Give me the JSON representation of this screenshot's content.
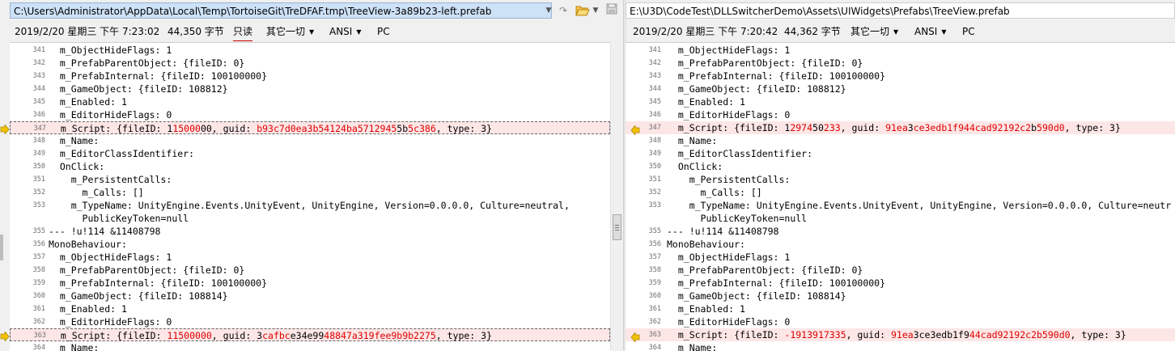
{
  "left": {
    "path": "C:\\Users\\Administrator\\AppData\\Local\\Temp\\TortoiseGit\\TreDFAF.tmp\\TreeView-3a89b23-left.prefab",
    "info": {
      "datetime": "2019/2/20 星期三 下午 7:23:02",
      "size": "44,350 字节",
      "readonly": "只读",
      "linefeed": "其它一切",
      "encoding": "ANSI",
      "platform": "PC"
    }
  },
  "right": {
    "path": "E:\\U3D\\CodeTest\\DLLSwitcherDemo\\Assets\\UIWidgets\\Prefabs\\TreeView.prefab",
    "info": {
      "datetime": "2019/2/20 星期三 下午 7:20:42",
      "size": "44,362 字节",
      "linefeed": "其它一切",
      "encoding": "ANSI",
      "platform": "PC"
    }
  },
  "icons": {
    "dropdown": "chevron-down-icon",
    "goto": "goto-icon",
    "open": "folder-open-icon",
    "save": "save-icon",
    "left_diff_arrow": "arrow-right-icon",
    "right_diff_arrow": "arrow-left-icon"
  },
  "colors": {
    "diff_bg": "#fde6e6",
    "diff_text": "#e00000",
    "arrow": "#f2c200",
    "path_selected_bg": "#cde1f7"
  },
  "left_lines": [
    {
      "n": "341",
      "segs": [
        {
          "t": "  m_ObjectHideFlags: 1"
        }
      ]
    },
    {
      "n": "342",
      "segs": [
        {
          "t": "  m_PrefabParentObject: {fileID: 0}"
        }
      ]
    },
    {
      "n": "343",
      "segs": [
        {
          "t": "  m_PrefabInternal: {fileID: 100100000}"
        }
      ]
    },
    {
      "n": "344",
      "segs": [
        {
          "t": "  m_GameObject: {fileID: 108812}"
        }
      ]
    },
    {
      "n": "345",
      "segs": [
        {
          "t": "  m_Enabled: 1"
        }
      ]
    },
    {
      "n": "346",
      "segs": [
        {
          "t": "  m_EditorHideFlags: 0"
        }
      ]
    },
    {
      "n": "347",
      "diff": true,
      "segs": [
        {
          "t": "  m_Script: {fileID: 1"
        },
        {
          "t": "15000",
          "h": true
        },
        {
          "t": "00, guid: "
        },
        {
          "t": "b93c7d0ea3b54124ba5712945",
          "h": true
        },
        {
          "t": "5b"
        },
        {
          "t": "5c386",
          "h": true
        },
        {
          "t": ", type: 3}"
        }
      ]
    },
    {
      "n": "348",
      "segs": [
        {
          "t": "  m_Name:"
        }
      ]
    },
    {
      "n": "349",
      "segs": [
        {
          "t": "  m_EditorClassIdentifier:"
        }
      ]
    },
    {
      "n": "350",
      "segs": [
        {
          "t": "  OnClick:"
        }
      ]
    },
    {
      "n": "351",
      "segs": [
        {
          "t": "    m_PersistentCalls:"
        }
      ]
    },
    {
      "n": "352",
      "segs": [
        {
          "t": "      m_Calls: []"
        }
      ]
    },
    {
      "n": "353",
      "segs": [
        {
          "t": "    m_TypeName: UnityEngine.Events.UnityEvent, UnityEngine, Version=0.0.0.0, Culture=neutral,"
        }
      ]
    },
    {
      "n": "",
      "segs": [
        {
          "t": "      PublicKeyToken=null"
        }
      ]
    },
    {
      "n": "355",
      "segs": [
        {
          "t": "--- !u!114 &11408798"
        }
      ]
    },
    {
      "n": "356",
      "segs": [
        {
          "t": "MonoBehaviour:"
        }
      ]
    },
    {
      "n": "357",
      "segs": [
        {
          "t": "  m_ObjectHideFlags: 1"
        }
      ]
    },
    {
      "n": "358",
      "segs": [
        {
          "t": "  m_PrefabParentObject: {fileID: 0}"
        }
      ]
    },
    {
      "n": "359",
      "segs": [
        {
          "t": "  m_PrefabInternal: {fileID: 100100000}"
        }
      ]
    },
    {
      "n": "360",
      "segs": [
        {
          "t": "  m_GameObject: {fileID: 108814}"
        }
      ]
    },
    {
      "n": "361",
      "segs": [
        {
          "t": "  m_Enabled: 1"
        }
      ]
    },
    {
      "n": "362",
      "segs": [
        {
          "t": "  m_EditorHideFlags: 0"
        }
      ]
    },
    {
      "n": "363",
      "diff": true,
      "segs": [
        {
          "t": "  m_Script: {fileID: "
        },
        {
          "t": "11500000",
          "h": true
        },
        {
          "t": ", guid: 3"
        },
        {
          "t": "cafbc",
          "h": true
        },
        {
          "t": "e34e99"
        },
        {
          "t": "48847a319fee9b9b2275",
          "h": true
        },
        {
          "t": ", type: 3}"
        }
      ]
    },
    {
      "n": "364",
      "segs": [
        {
          "t": "  m_Name:"
        }
      ]
    }
  ],
  "right_lines": [
    {
      "n": "341",
      "segs": [
        {
          "t": "  m_ObjectHideFlags: 1"
        }
      ]
    },
    {
      "n": "342",
      "segs": [
        {
          "t": "  m_PrefabParentObject: {fileID: 0}"
        }
      ]
    },
    {
      "n": "343",
      "segs": [
        {
          "t": "  m_PrefabInternal: {fileID: 100100000}"
        }
      ]
    },
    {
      "n": "344",
      "segs": [
        {
          "t": "  m_GameObject: {fileID: 108812}"
        }
      ]
    },
    {
      "n": "345",
      "segs": [
        {
          "t": "  m_Enabled: 1"
        }
      ]
    },
    {
      "n": "346",
      "segs": [
        {
          "t": "  m_EditorHideFlags: 0"
        }
      ]
    },
    {
      "n": "347",
      "diff": true,
      "segs": [
        {
          "t": "  m_Script: {fileID: 1"
        },
        {
          "t": "2974",
          "h": true
        },
        {
          "t": "50"
        },
        {
          "t": "233",
          "h": true
        },
        {
          "t": ", guid: "
        },
        {
          "t": "91ea",
          "h": true
        },
        {
          "t": "3"
        },
        {
          "t": "ce3edb1f944cad92192c2",
          "h": true
        },
        {
          "t": "b"
        },
        {
          "t": "590d0",
          "h": true
        },
        {
          "t": ", type: 3}"
        }
      ]
    },
    {
      "n": "348",
      "segs": [
        {
          "t": "  m_Name:"
        }
      ]
    },
    {
      "n": "349",
      "segs": [
        {
          "t": "  m_EditorClassIdentifier:"
        }
      ]
    },
    {
      "n": "350",
      "segs": [
        {
          "t": "  OnClick:"
        }
      ]
    },
    {
      "n": "351",
      "segs": [
        {
          "t": "    m_PersistentCalls:"
        }
      ]
    },
    {
      "n": "352",
      "segs": [
        {
          "t": "      m_Calls: []"
        }
      ]
    },
    {
      "n": "353",
      "segs": [
        {
          "t": "    m_TypeName: UnityEngine.Events.UnityEvent, UnityEngine, Version=0.0.0.0, Culture=neutr"
        }
      ]
    },
    {
      "n": "",
      "segs": [
        {
          "t": "      PublicKeyToken=null"
        }
      ]
    },
    {
      "n": "355",
      "segs": [
        {
          "t": "--- !u!114 &11408798"
        }
      ]
    },
    {
      "n": "356",
      "segs": [
        {
          "t": "MonoBehaviour:"
        }
      ]
    },
    {
      "n": "357",
      "segs": [
        {
          "t": "  m_ObjectHideFlags: 1"
        }
      ]
    },
    {
      "n": "358",
      "segs": [
        {
          "t": "  m_PrefabParentObject: {fileID: 0}"
        }
      ]
    },
    {
      "n": "359",
      "segs": [
        {
          "t": "  m_PrefabInternal: {fileID: 100100000}"
        }
      ]
    },
    {
      "n": "360",
      "segs": [
        {
          "t": "  m_GameObject: {fileID: 108814}"
        }
      ]
    },
    {
      "n": "361",
      "segs": [
        {
          "t": "  m_Enabled: 1"
        }
      ]
    },
    {
      "n": "362",
      "segs": [
        {
          "t": "  m_EditorHideFlags: 0"
        }
      ]
    },
    {
      "n": "363",
      "diff": true,
      "segs": [
        {
          "t": "  m_Script: {fileID: "
        },
        {
          "t": "-1913917335",
          "h": true
        },
        {
          "t": ", guid: "
        },
        {
          "t": "91ea",
          "h": true
        },
        {
          "t": "3ce3edb1f9"
        },
        {
          "t": "44cad92192c2b590d0",
          "h": true
        },
        {
          "t": ", type: 3}"
        }
      ]
    },
    {
      "n": "364",
      "segs": [
        {
          "t": "  m_Name:"
        }
      ]
    }
  ]
}
